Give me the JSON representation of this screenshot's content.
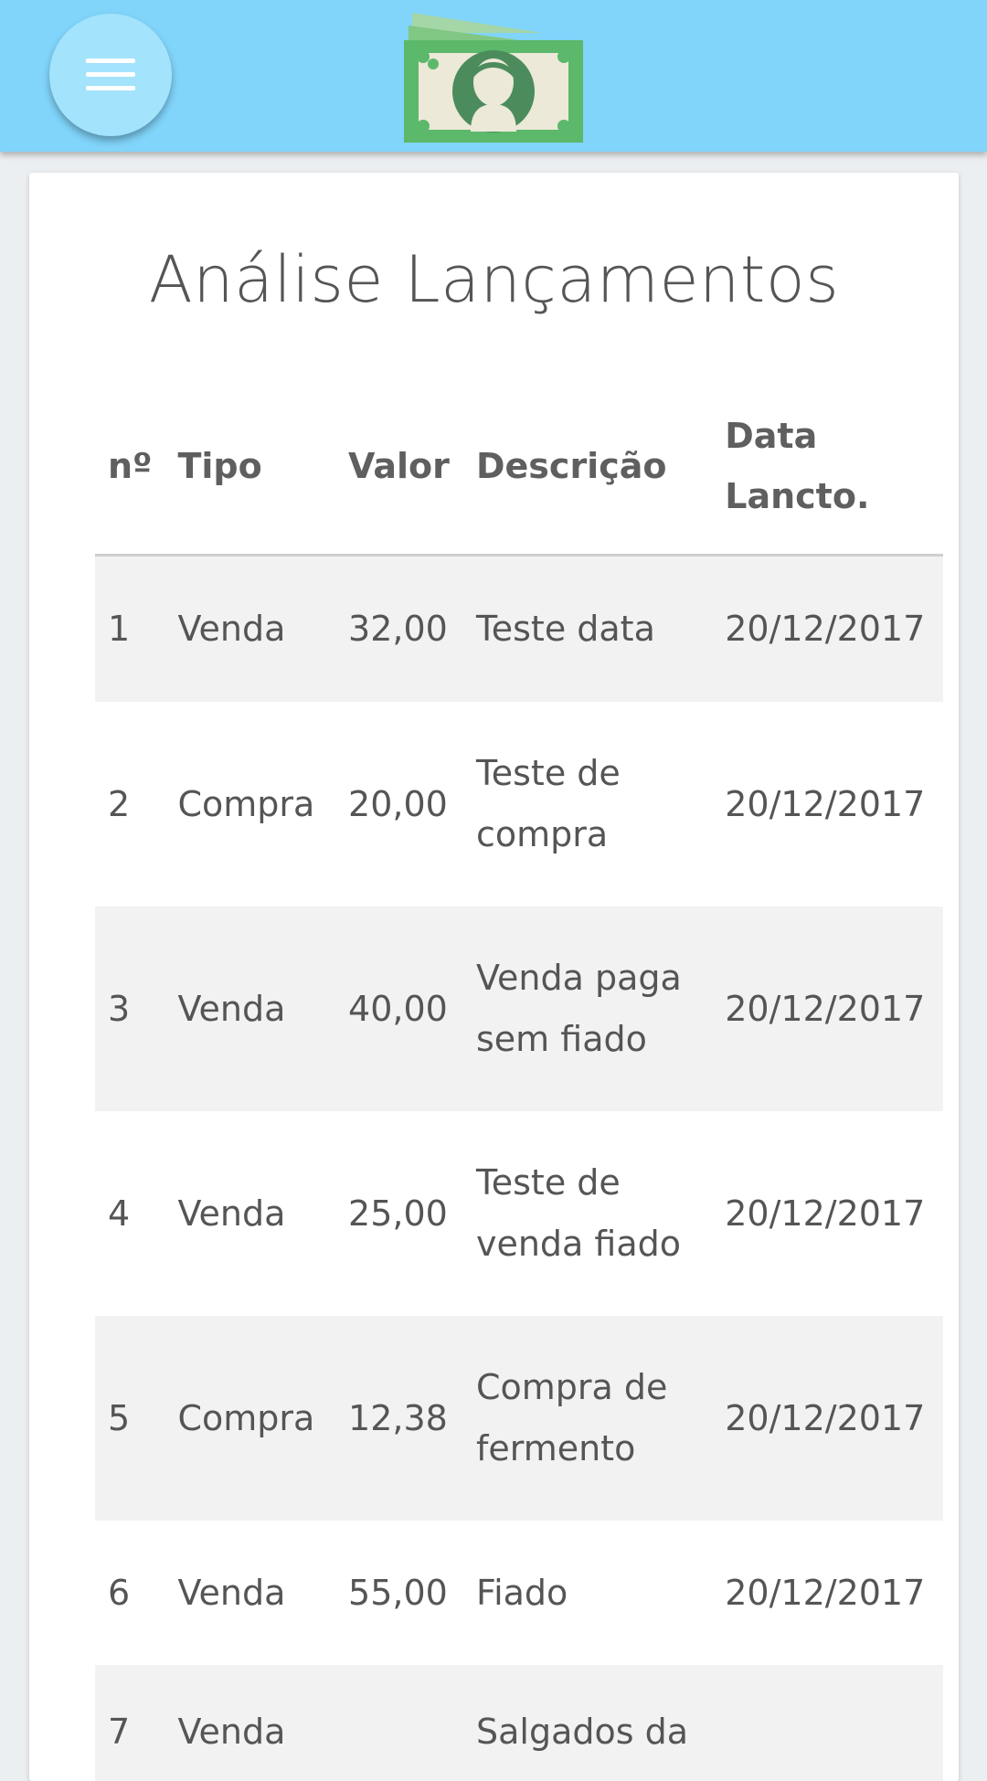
{
  "header": {
    "menu_icon": "hamburger-menu-icon",
    "logo_icon": "money-bill-icon"
  },
  "page": {
    "title": "Análise Lançamentos"
  },
  "table": {
    "columns": [
      "nº",
      "Tipo",
      "Valor",
      "Descrição",
      "Data Lancto."
    ],
    "rows": [
      {
        "num": "1",
        "tipo": "Venda",
        "valor": "32,00",
        "descricao": "Teste data",
        "data": "20/12/2017"
      },
      {
        "num": "2",
        "tipo": "Compra",
        "valor": "20,00",
        "descricao": "Teste de compra",
        "data": "20/12/2017"
      },
      {
        "num": "3",
        "tipo": "Venda",
        "valor": "40,00",
        "descricao": "Venda paga sem fiado",
        "data": "20/12/2017"
      },
      {
        "num": "4",
        "tipo": "Venda",
        "valor": "25,00",
        "descricao": "Teste de venda fiado",
        "data": "20/12/2017"
      },
      {
        "num": "5",
        "tipo": "Compra",
        "valor": "12,38",
        "descricao": "Compra de fermento",
        "data": "20/12/2017"
      },
      {
        "num": "6",
        "tipo": "Venda",
        "valor": "55,00",
        "descricao": "Fiado",
        "data": "20/12/2017"
      },
      {
        "num": "7",
        "tipo": "Venda",
        "valor": "",
        "descricao": "Salgados da",
        "data": ""
      }
    ]
  },
  "colors": {
    "app_bar": "#81d4fa",
    "menu_button": "#a3e3fc",
    "bill_green": "#5cb86a",
    "striped_row": "#f2f2f2"
  }
}
